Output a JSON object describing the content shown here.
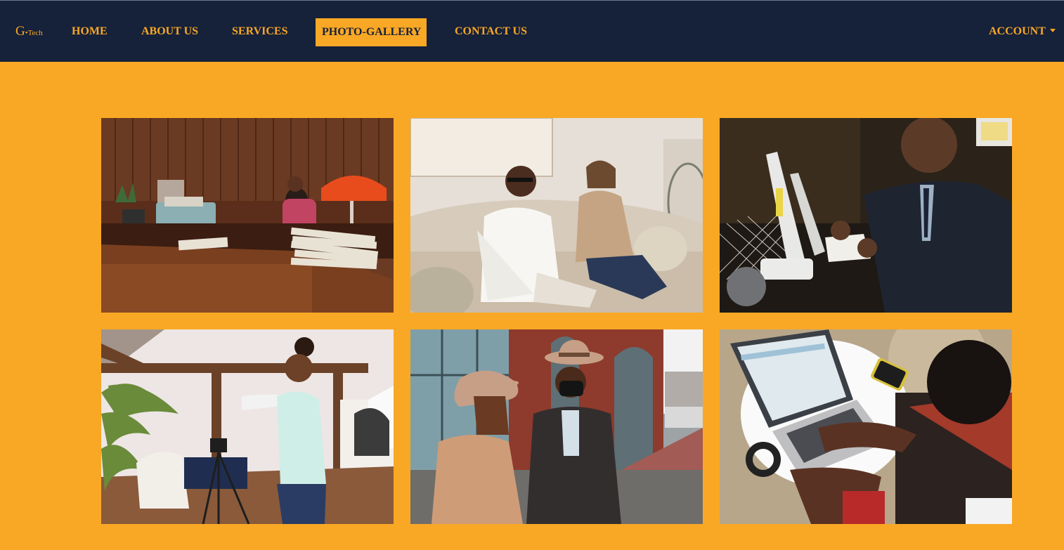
{
  "brand": {
    "logo_main": "G",
    "logo_sub": "Tech"
  },
  "nav": {
    "home": "HOME",
    "about": "ABOUT US",
    "services": "SERVICES",
    "gallery": "PHOTO-GALLERY",
    "contact": "CONTACT US",
    "account": "ACCOUNT"
  },
  "colors": {
    "navbar_bg": "#16213a",
    "accent": "#f9a825",
    "page_bg": "#f9a825"
  },
  "gallery": {
    "photos": [
      {
        "subject": "woman on telephone at office desk with orange lamp and typewriter"
      },
      {
        "subject": "man in sunglasses and woman talking on sofa"
      },
      {
        "subject": "man in suit writing at desk with computer"
      },
      {
        "subject": "woman stretching arm in studio with camera tripod"
      },
      {
        "subject": "two people in hats and coats talking on street"
      },
      {
        "subject": "person typing on laptop at round white table, top view"
      }
    ]
  }
}
